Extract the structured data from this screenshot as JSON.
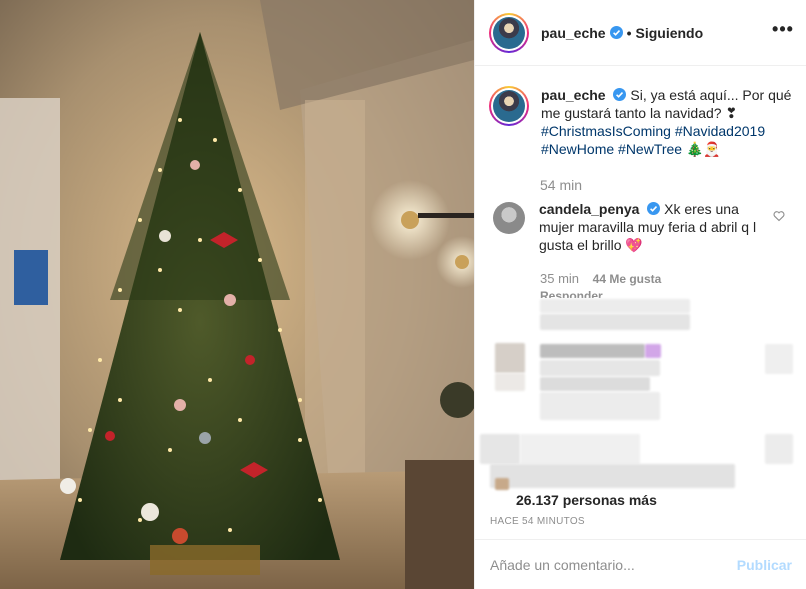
{
  "post": {
    "author": "pau_eche",
    "follow_status": "Siguiendo",
    "more_icon": "more-dots-icon",
    "caption_text": "Si, ya está aquí... Por qué me gustará tanto la navidad? ❣",
    "caption_tags_line1": "#ChristmasIsComing #Navidad2019",
    "caption_tags_line2": "#NewHome #NewTree 🎄🎅",
    "caption_time": "54 min"
  },
  "comment": {
    "author": "candela_penya",
    "text": "Xk eres una mujer maravilla muy feria d abril q l gusta el brillo 💖",
    "time": "35 min",
    "likes": "44 Me gusta",
    "reply_label": "Responder"
  },
  "likes_summary": "26.137 personas más",
  "posted_time": "HACE 54 MINUTOS",
  "comment_box": {
    "placeholder": "Añade un comentario...",
    "publish_label": "Publicar"
  },
  "colors": {
    "link": "#00376b",
    "secondary_text": "#8e8e8e",
    "verified_blue": "#3897f0",
    "publish_disabled": "#b3dbff"
  }
}
